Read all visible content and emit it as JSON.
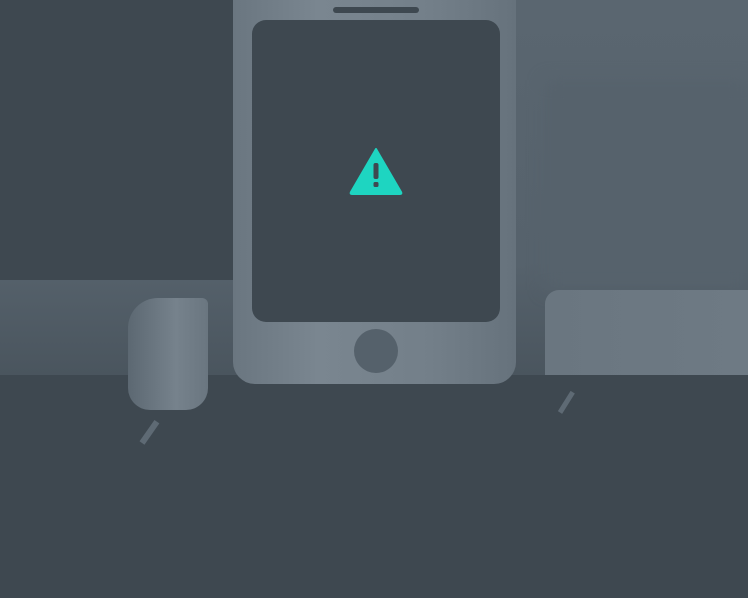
{
  "illustration": {
    "subject": "phone-warning",
    "icon": "warning-icon",
    "colors": {
      "background": "#3e4850",
      "phone_body": "#737f89",
      "screen": "#3e4850",
      "accent": "#1ed5c1"
    }
  }
}
